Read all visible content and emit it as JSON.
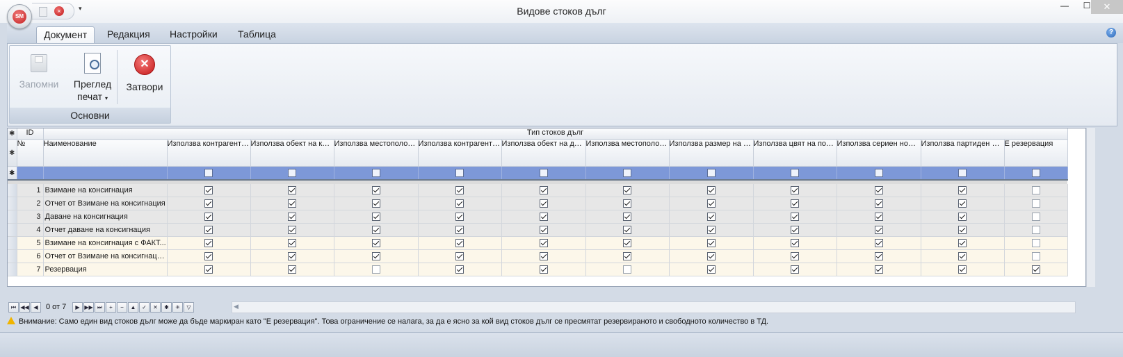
{
  "window": {
    "title": "Видове стоков дълг",
    "minimize_glyph": "—",
    "maximize_glyph": "☐",
    "close_glyph": "✕"
  },
  "app": {
    "logo_text": "SM"
  },
  "quick_access": {
    "customize_glyph": "▾"
  },
  "ribbon": {
    "tabs": [
      {
        "label": "Документ",
        "active": true
      },
      {
        "label": "Редакция",
        "active": false
      },
      {
        "label": "Настройки",
        "active": false
      },
      {
        "label": "Таблица",
        "active": false
      }
    ],
    "help_glyph": "?",
    "group": {
      "label": "Основни",
      "save_label": "Запомни",
      "preview_label_line1": "Преглед",
      "preview_label_line2": "печат",
      "close_label": "Затвори"
    }
  },
  "grid": {
    "band_id": "ID",
    "band_title": "Тип стоков дълг",
    "columns": [
      "№",
      "Наименование",
      "Използва контрагент на кредитора",
      "Използва обект на кредитора",
      "Използва местоположение на кредитора",
      "Използва контрагент на длъжника",
      "Използва обект на длъжника",
      "Използва местоположение на длъжника",
      "Използва размер на позиция",
      "Използва цвят на позиция",
      "Използва сериен номер",
      "Използва партиден номер",
      "Е резервация"
    ],
    "rows": [
      {
        "num": "1",
        "name": "Взимане на консигнация",
        "style": "gray",
        "flags": [
          true,
          true,
          true,
          true,
          true,
          true,
          true,
          true,
          true,
          true,
          false
        ]
      },
      {
        "num": "2",
        "name": "Отчет от Взимане на консигнация",
        "style": "gray",
        "flags": [
          true,
          true,
          true,
          true,
          true,
          true,
          true,
          true,
          true,
          true,
          false
        ]
      },
      {
        "num": "3",
        "name": "Даване на консигнация",
        "style": "gray",
        "flags": [
          true,
          true,
          true,
          true,
          true,
          true,
          true,
          true,
          true,
          true,
          false
        ]
      },
      {
        "num": "4",
        "name": "Отчет даване на консигнация",
        "style": "gray",
        "flags": [
          true,
          true,
          true,
          true,
          true,
          true,
          true,
          true,
          true,
          true,
          false
        ]
      },
      {
        "num": "5",
        "name": "Взимане на консигнация с ФАКТ...",
        "style": "cream",
        "flags": [
          true,
          true,
          true,
          true,
          true,
          true,
          true,
          true,
          true,
          true,
          false
        ]
      },
      {
        "num": "6",
        "name": "Отчет от Взимане на консигнаци...",
        "style": "cream",
        "flags": [
          true,
          true,
          true,
          true,
          true,
          true,
          true,
          true,
          true,
          true,
          false
        ]
      },
      {
        "num": "7",
        "name": "Резервация",
        "style": "cream",
        "flags": [
          true,
          true,
          false,
          true,
          true,
          false,
          true,
          true,
          true,
          true,
          true
        ]
      }
    ]
  },
  "navigator": {
    "position_text": "0 от 7"
  },
  "warning": {
    "text": "Внимание: Само един вид стоков дълг може да бъде маркиран като \"Е резервация\". Това ограничение се налага, за да е ясно за кой вид стоков дълг се пресмятат резервираното и свободното количество в ТД."
  }
}
